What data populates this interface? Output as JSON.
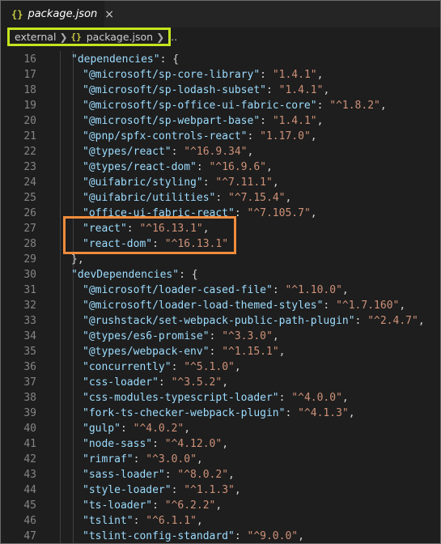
{
  "tab": {
    "icon": "json-file-icon",
    "braces": "{}",
    "title": "package.json",
    "close": "×"
  },
  "breadcrumb": {
    "folder": "external",
    "file_braces": "{}",
    "file": "package.json",
    "more": "..."
  },
  "lines": [
    {
      "n": "16",
      "k": "\"dependencies\"",
      "m": ": {",
      "v": "",
      "e": "",
      "indent": 1
    },
    {
      "n": "17",
      "k": "\"@microsoft/sp-core-library\"",
      "m": ": ",
      "v": "\"1.4.1\"",
      "e": ",",
      "indent": 2
    },
    {
      "n": "18",
      "k": "\"@microsoft/sp-lodash-subset\"",
      "m": ": ",
      "v": "\"1.4.1\"",
      "e": ",",
      "indent": 2
    },
    {
      "n": "19",
      "k": "\"@microsoft/sp-office-ui-fabric-core\"",
      "m": ": ",
      "v": "\"^1.8.2\"",
      "e": ",",
      "indent": 2
    },
    {
      "n": "20",
      "k": "\"@microsoft/sp-webpart-base\"",
      "m": ": ",
      "v": "\"1.4.1\"",
      "e": ",",
      "indent": 2
    },
    {
      "n": "21",
      "k": "\"@pnp/spfx-controls-react\"",
      "m": ": ",
      "v": "\"1.17.0\"",
      "e": ",",
      "indent": 2
    },
    {
      "n": "22",
      "k": "\"@types/react\"",
      "m": ": ",
      "v": "\"^16.9.34\"",
      "e": ",",
      "indent": 2
    },
    {
      "n": "23",
      "k": "\"@types/react-dom\"",
      "m": ": ",
      "v": "\"^16.9.6\"",
      "e": ",",
      "indent": 2
    },
    {
      "n": "24",
      "k": "\"@uifabric/styling\"",
      "m": ": ",
      "v": "\"^7.11.1\"",
      "e": ",",
      "indent": 2
    },
    {
      "n": "25",
      "k": "\"@uifabric/utilities\"",
      "m": ": ",
      "v": "\"^7.15.4\"",
      "e": ",",
      "indent": 2
    },
    {
      "n": "26",
      "k": "\"office-ui-fabric-react\"",
      "m": ": ",
      "v": "\"^7.105.7\"",
      "e": ",",
      "indent": 2
    },
    {
      "n": "27",
      "k": "\"react\"",
      "m": ": ",
      "v": "\"^16.13.1\"",
      "e": ",",
      "indent": 2
    },
    {
      "n": "28",
      "k": "\"react-dom\"",
      "m": ": ",
      "v": "\"^16.13.1\"",
      "e": "",
      "indent": 2
    },
    {
      "n": "29",
      "k": "",
      "m": "},",
      "v": "",
      "e": "",
      "indent": 1
    },
    {
      "n": "30",
      "k": "\"devDependencies\"",
      "m": ": {",
      "v": "",
      "e": "",
      "indent": 1
    },
    {
      "n": "31",
      "k": "\"@microsoft/loader-cased-file\"",
      "m": ": ",
      "v": "\"^1.10.0\"",
      "e": ",",
      "indent": 2
    },
    {
      "n": "32",
      "k": "\"@microsoft/loader-load-themed-styles\"",
      "m": ": ",
      "v": "\"^1.7.160\"",
      "e": ",",
      "indent": 2
    },
    {
      "n": "33",
      "k": "\"@rushstack/set-webpack-public-path-plugin\"",
      "m": ": ",
      "v": "\"^2.4.7\"",
      "e": ",",
      "indent": 2
    },
    {
      "n": "34",
      "k": "\"@types/es6-promise\"",
      "m": ": ",
      "v": "\"^3.3.0\"",
      "e": ",",
      "indent": 2
    },
    {
      "n": "35",
      "k": "\"@types/webpack-env\"",
      "m": ": ",
      "v": "\"^1.15.1\"",
      "e": ",",
      "indent": 2
    },
    {
      "n": "36",
      "k": "\"concurrently\"",
      "m": ": ",
      "v": "\"^5.1.0\"",
      "e": ",",
      "indent": 2
    },
    {
      "n": "37",
      "k": "\"css-loader\"",
      "m": ": ",
      "v": "\"^3.5.2\"",
      "e": ",",
      "indent": 2
    },
    {
      "n": "38",
      "k": "\"css-modules-typescript-loader\"",
      "m": ": ",
      "v": "\"^4.0.0\"",
      "e": ",",
      "indent": 2
    },
    {
      "n": "39",
      "k": "\"fork-ts-checker-webpack-plugin\"",
      "m": ": ",
      "v": "\"^4.1.3\"",
      "e": ",",
      "indent": 2
    },
    {
      "n": "40",
      "k": "\"gulp\"",
      "m": ": ",
      "v": "\"^4.0.2\"",
      "e": ",",
      "indent": 2
    },
    {
      "n": "41",
      "k": "\"node-sass\"",
      "m": ": ",
      "v": "\"^4.12.0\"",
      "e": ",",
      "indent": 2
    },
    {
      "n": "42",
      "k": "\"rimraf\"",
      "m": ": ",
      "v": "\"^3.0.0\"",
      "e": ",",
      "indent": 2
    },
    {
      "n": "43",
      "k": "\"sass-loader\"",
      "m": ": ",
      "v": "\"^8.0.2\"",
      "e": ",",
      "indent": 2
    },
    {
      "n": "44",
      "k": "\"style-loader\"",
      "m": ": ",
      "v": "\"^1.1.3\"",
      "e": ",",
      "indent": 2
    },
    {
      "n": "45",
      "k": "\"ts-loader\"",
      "m": ": ",
      "v": "\"^6.2.2\"",
      "e": ",",
      "indent": 2
    },
    {
      "n": "46",
      "k": "\"tslint\"",
      "m": ": ",
      "v": "\"^6.1.1\"",
      "e": ",",
      "indent": 2
    },
    {
      "n": "47",
      "k": "\"tslint-config-standard\"",
      "m": ": ",
      "v": "\"^9.0.0\"",
      "e": ",",
      "indent": 2
    }
  ],
  "colors": {
    "background": "#1e1e1e",
    "json_key": "#9cdcfe",
    "json_string": "#ce9178",
    "line_number": "#858585",
    "breadcrumb_highlight": "#c6e41f",
    "react_highlight": "#f08c3c"
  }
}
